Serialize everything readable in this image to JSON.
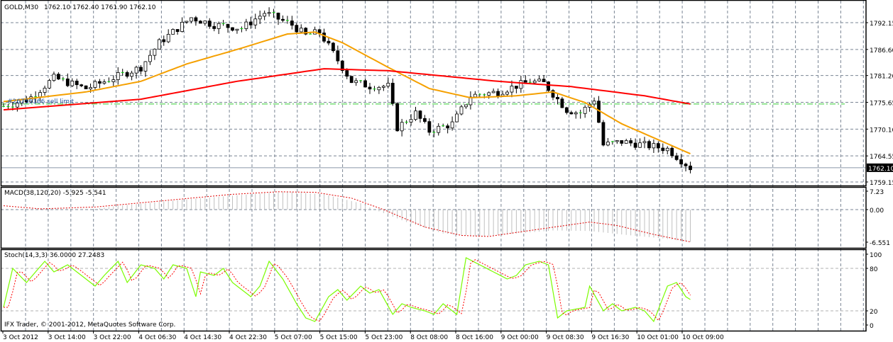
{
  "header": {
    "symbol": "GOLD,M30",
    "ohlc": "1762.10 1762.40 1761.90 1762.10"
  },
  "order_label": "#26755166 sell limit",
  "copyright": "IFX Trader, © 2001-2012, MetaQuotes Software Corp.",
  "colors": {
    "ma_fast": "#f5a000",
    "ma_slow": "#ff0000",
    "stoch_main": "#7cfc00",
    "stoch_signal": "#ff0000",
    "macd_hist": "#c0c0c0",
    "grid": "#7a8594",
    "order_line": "#33cc33"
  },
  "price_axis": {
    "labels": [
      "1792.15",
      "1786.60",
      "1781.20",
      "1775.65",
      "1770.10",
      "1764.55",
      "1759.15"
    ],
    "current": "1762.10"
  },
  "macd": {
    "label": "MACD(38,120,20) -5.925 -5.541",
    "axis": [
      "7.23",
      "0.00",
      "-6.551"
    ]
  },
  "stoch": {
    "label": "Stoch(14,3,3) 36.0000 27.2483",
    "axis": [
      "100",
      "80",
      "20",
      "0"
    ]
  },
  "time_axis": [
    "3 Oct 2012",
    "3 Oct 14:00",
    "3 Oct 22:00",
    "4 Oct 06:30",
    "4 Oct 14:30",
    "4 Oct 22:30",
    "5 Oct 07:00",
    "5 Oct 15:00",
    "5 Oct 23:00",
    "8 Oct 08:00",
    "8 Oct 16:00",
    "9 Oct 00:00",
    "9 Oct 08:30",
    "9 Oct 16:30",
    "10 Oct 01:00",
    "10 Oct 09:00"
  ],
  "chart_data": {
    "type": "candlestick",
    "price_range": [
      1759.15,
      1792.15
    ],
    "sell_limit_price": 1775.3,
    "current_price": 1762.1,
    "close_path": [
      [
        0,
        1774.8
      ],
      [
        5.5,
        1776.3
      ],
      [
        11,
        1780.7
      ],
      [
        18,
        1778.5
      ],
      [
        24,
        1780.7
      ],
      [
        30,
        1782.9
      ],
      [
        34,
        1788.0
      ],
      [
        41,
        1793.2
      ],
      [
        46,
        1791.7
      ],
      [
        52,
        1791.0
      ],
      [
        57,
        1794.2
      ],
      [
        63,
        1791.7
      ],
      [
        66,
        1789.5
      ],
      [
        69,
        1790.2
      ],
      [
        72,
        1785.8
      ],
      [
        76,
        1780.0
      ],
      [
        80,
        1779.0
      ],
      [
        84,
        1779.0
      ],
      [
        86,
        1770.4
      ],
      [
        90,
        1773.4
      ],
      [
        93,
        1769.7
      ],
      [
        98,
        1771.2
      ],
      [
        102,
        1777.0
      ],
      [
        108,
        1777.8
      ],
      [
        115,
        1780.0
      ],
      [
        118,
        1779.6
      ],
      [
        123,
        1774.1
      ],
      [
        126,
        1773.4
      ],
      [
        129,
        1776.3
      ],
      [
        131,
        1766.8
      ],
      [
        135,
        1767.5
      ],
      [
        140,
        1766.8
      ],
      [
        145,
        1766.0
      ],
      [
        150,
        1762.1
      ]
    ],
    "ma_fast": [
      [
        0,
        1775.8
      ],
      [
        18,
        1777.8
      ],
      [
        30,
        1780.0
      ],
      [
        40,
        1783.6
      ],
      [
        51,
        1786.6
      ],
      [
        62,
        1789.8
      ],
      [
        68,
        1790.2
      ],
      [
        74,
        1788.0
      ],
      [
        84,
        1782.9
      ],
      [
        93,
        1778.5
      ],
      [
        102,
        1776.6
      ],
      [
        112,
        1777.0
      ],
      [
        120,
        1777.8
      ],
      [
        127,
        1775.6
      ],
      [
        135,
        1771.2
      ],
      [
        150,
        1765.0
      ]
    ],
    "ma_slow": [
      [
        0,
        1774.1
      ],
      [
        30,
        1776.3
      ],
      [
        51,
        1780.0
      ],
      [
        70,
        1782.6
      ],
      [
        84,
        1782.2
      ],
      [
        108,
        1780.0
      ],
      [
        124,
        1778.9
      ],
      [
        140,
        1777.0
      ],
      [
        150,
        1775.3
      ]
    ],
    "macd_hist": [
      [
        0,
        0
      ],
      [
        20,
        0.3
      ],
      [
        25,
        1.5
      ],
      [
        40,
        4.0
      ],
      [
        55,
        6.2
      ],
      [
        62,
        7.0
      ],
      [
        70,
        6.0
      ],
      [
        78,
        2.5
      ],
      [
        81,
        0
      ],
      [
        88,
        -2.5
      ],
      [
        96,
        -4.8
      ],
      [
        104,
        -5.4
      ],
      [
        112,
        -4.8
      ],
      [
        120,
        -4.2
      ],
      [
        128,
        -4.3
      ],
      [
        135,
        -5.0
      ],
      [
        144,
        -5.8
      ],
      [
        150,
        -6.5
      ]
    ],
    "macd_signal": [
      [
        0,
        1.5
      ],
      [
        8,
        0.3
      ],
      [
        20,
        1.0
      ],
      [
        35,
        3.5
      ],
      [
        50,
        6.0
      ],
      [
        60,
        7.0
      ],
      [
        68,
        6.8
      ],
      [
        76,
        4.5
      ],
      [
        83,
        0
      ],
      [
        92,
        -3.5
      ],
      [
        100,
        -5.2
      ],
      [
        106,
        -5.4
      ],
      [
        115,
        -4.2
      ],
      [
        128,
        -2.5
      ],
      [
        134,
        -3.2
      ],
      [
        142,
        -5.0
      ],
      [
        150,
        -6.5
      ]
    ],
    "stoch_main": [
      [
        0,
        25
      ],
      [
        2,
        80
      ],
      [
        5,
        60
      ],
      [
        9,
        90
      ],
      [
        11,
        75
      ],
      [
        14,
        85
      ],
      [
        17,
        70
      ],
      [
        20,
        55
      ],
      [
        22,
        70
      ],
      [
        25,
        90
      ],
      [
        27,
        60
      ],
      [
        30,
        85
      ],
      [
        33,
        80
      ],
      [
        35,
        65
      ],
      [
        37,
        85
      ],
      [
        40,
        80
      ],
      [
        42,
        40
      ],
      [
        43,
        75
      ],
      [
        46,
        70
      ],
      [
        48,
        80
      ],
      [
        50,
        60
      ],
      [
        54,
        40
      ],
      [
        56,
        55
      ],
      [
        58,
        90
      ],
      [
        61,
        65
      ],
      [
        64,
        30
      ],
      [
        66,
        10
      ],
      [
        68,
        5
      ],
      [
        71,
        40
      ],
      [
        73,
        50
      ],
      [
        75,
        35
      ],
      [
        78,
        55
      ],
      [
        80,
        45
      ],
      [
        82,
        50
      ],
      [
        85,
        15
      ],
      [
        87,
        30
      ],
      [
        89,
        25
      ],
      [
        92,
        20
      ],
      [
        94,
        15
      ],
      [
        96,
        30
      ],
      [
        99,
        15
      ],
      [
        101,
        95
      ],
      [
        104,
        85
      ],
      [
        107,
        75
      ],
      [
        110,
        65
      ],
      [
        112,
        70
      ],
      [
        114,
        85
      ],
      [
        117,
        90
      ],
      [
        119,
        85
      ],
      [
        121,
        10
      ],
      [
        123,
        20
      ],
      [
        127,
        25
      ],
      [
        128,
        55
      ],
      [
        131,
        20
      ],
      [
        133,
        30
      ],
      [
        135,
        20
      ],
      [
        138,
        25
      ],
      [
        140,
        20
      ],
      [
        142,
        5
      ],
      [
        145,
        55
      ],
      [
        147,
        60
      ],
      [
        149,
        40
      ],
      [
        150,
        36
      ]
    ],
    "time_labels_count": 16
  }
}
